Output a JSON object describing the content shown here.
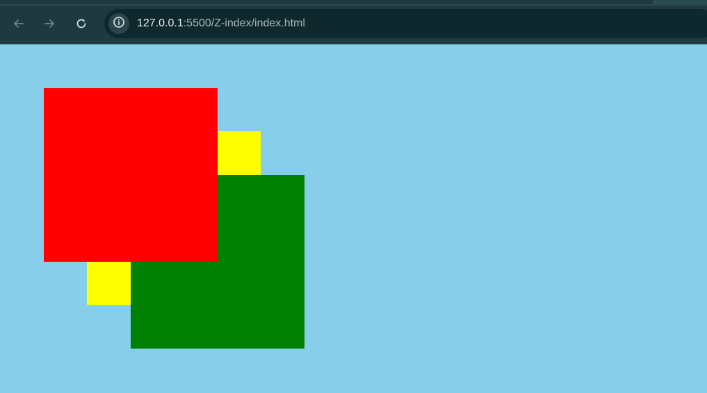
{
  "browser": {
    "url_host": "127.0.0.1",
    "url_path": ":5500/Z-index/index.html",
    "icons": {
      "back": "arrow-left-icon",
      "forward": "arrow-right-icon",
      "reload": "reload-icon",
      "site_info": "info-icon"
    },
    "colors": {
      "toolbar": "#1e3a40",
      "omnibox": "#0f282d"
    }
  },
  "page": {
    "background": "#87ceeb",
    "boxes": [
      {
        "name": "yellow-box",
        "color": "#ffff00",
        "z_index": 1
      },
      {
        "name": "green-box",
        "color": "#008000",
        "z_index": 2
      },
      {
        "name": "red-box",
        "color": "#ff0000",
        "z_index": 3
      }
    ]
  }
}
